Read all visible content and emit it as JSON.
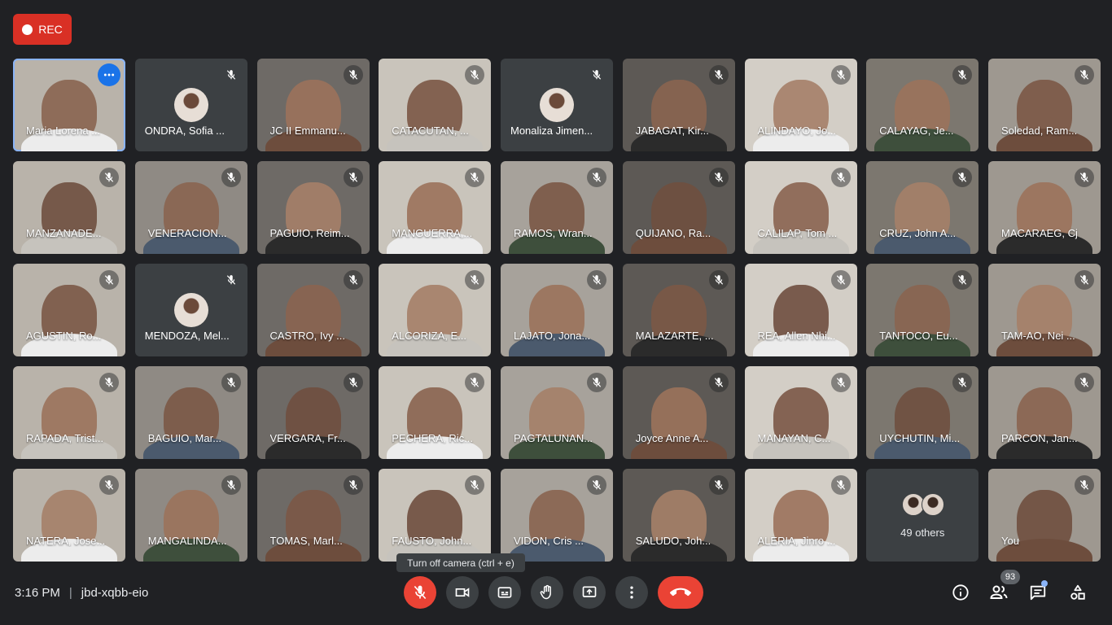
{
  "recording": {
    "label": "REC"
  },
  "participants": [
    {
      "name": "Maria Lorena ...",
      "video": true,
      "active": true
    },
    {
      "name": "ONDRA, Sofia ...",
      "video": false
    },
    {
      "name": "JC II Emmanu...",
      "video": true
    },
    {
      "name": "CATACUTAN, ...",
      "video": true
    },
    {
      "name": "Monaliza Jimen...",
      "video": false
    },
    {
      "name": "JABAGAT, Kir...",
      "video": true
    },
    {
      "name": "ALINDAYO, Jo...",
      "video": true
    },
    {
      "name": "CALAYAG, Je...",
      "video": true
    },
    {
      "name": "Soledad, Ram...",
      "video": true
    },
    {
      "name": "MANZANADE...",
      "video": true
    },
    {
      "name": "VENERACION...",
      "video": true
    },
    {
      "name": "PAGUIO, Reim...",
      "video": true
    },
    {
      "name": "MANGUERRA,...",
      "video": true
    },
    {
      "name": "RAMOS, Wran...",
      "video": true
    },
    {
      "name": "QUIJANO, Ra...",
      "video": true
    },
    {
      "name": "CALILAP, Tom ...",
      "video": true
    },
    {
      "name": "CRUZ, John A...",
      "video": true
    },
    {
      "name": "MACARAEG, Cj",
      "video": true
    },
    {
      "name": "AGUSTIN, Ro...",
      "video": true
    },
    {
      "name": "MENDOZA, Mel...",
      "video": false
    },
    {
      "name": "CASTRO, Ivy ...",
      "video": true
    },
    {
      "name": "ALCORIZA, E...",
      "video": true
    },
    {
      "name": "LAJATO, Jona...",
      "video": true
    },
    {
      "name": "MALAZARTE, ...",
      "video": true
    },
    {
      "name": "REA, Allen Nhi...",
      "video": true
    },
    {
      "name": "TANTOCO, Eu...",
      "video": true
    },
    {
      "name": "TAM-AO, Nei ...",
      "video": true
    },
    {
      "name": "RAPADA, Trist...",
      "video": true
    },
    {
      "name": "BAGUIO, Mar...",
      "video": true
    },
    {
      "name": "VERGARA, Fr...",
      "video": true
    },
    {
      "name": "PECHERA, Ric...",
      "video": true
    },
    {
      "name": "PAGTALUNAN...",
      "video": true
    },
    {
      "name": "Joyce Anne A...",
      "video": true
    },
    {
      "name": "MANAYAN, C...",
      "video": true
    },
    {
      "name": "UYCHUTIN, Mi...",
      "video": true
    },
    {
      "name": "PARCON, Jan...",
      "video": true
    },
    {
      "name": "NATERA, Jose...",
      "video": true
    },
    {
      "name": "MANGALINDA...",
      "video": true
    },
    {
      "name": "TOMAS, Marl...",
      "video": true
    },
    {
      "name": "FAUSTO, John...",
      "video": true
    },
    {
      "name": "VIDON, Cris ...",
      "video": true
    },
    {
      "name": "SALUDO, Joh...",
      "video": true
    },
    {
      "name": "ALERIA, Jinro ...",
      "video": true
    },
    {
      "name": "49 others",
      "video": false,
      "others": true
    },
    {
      "name": "You",
      "video": true
    }
  ],
  "tooltip": "Turn off camera (ctrl + e)",
  "meeting": {
    "time": "3:16 PM",
    "separator": "|",
    "code": "jbd-xqbb-eio"
  },
  "people_count": "93",
  "colors": {
    "accent": "#8ab4f8",
    "danger": "#ea4335",
    "surface": "#3c4043",
    "background": "#202124"
  },
  "icons": [
    "mic-off-icon",
    "camera-icon",
    "captions-icon",
    "raise-hand-icon",
    "present-icon",
    "more-options-icon",
    "end-call-icon",
    "info-icon",
    "people-icon",
    "chat-icon",
    "activities-icon"
  ]
}
